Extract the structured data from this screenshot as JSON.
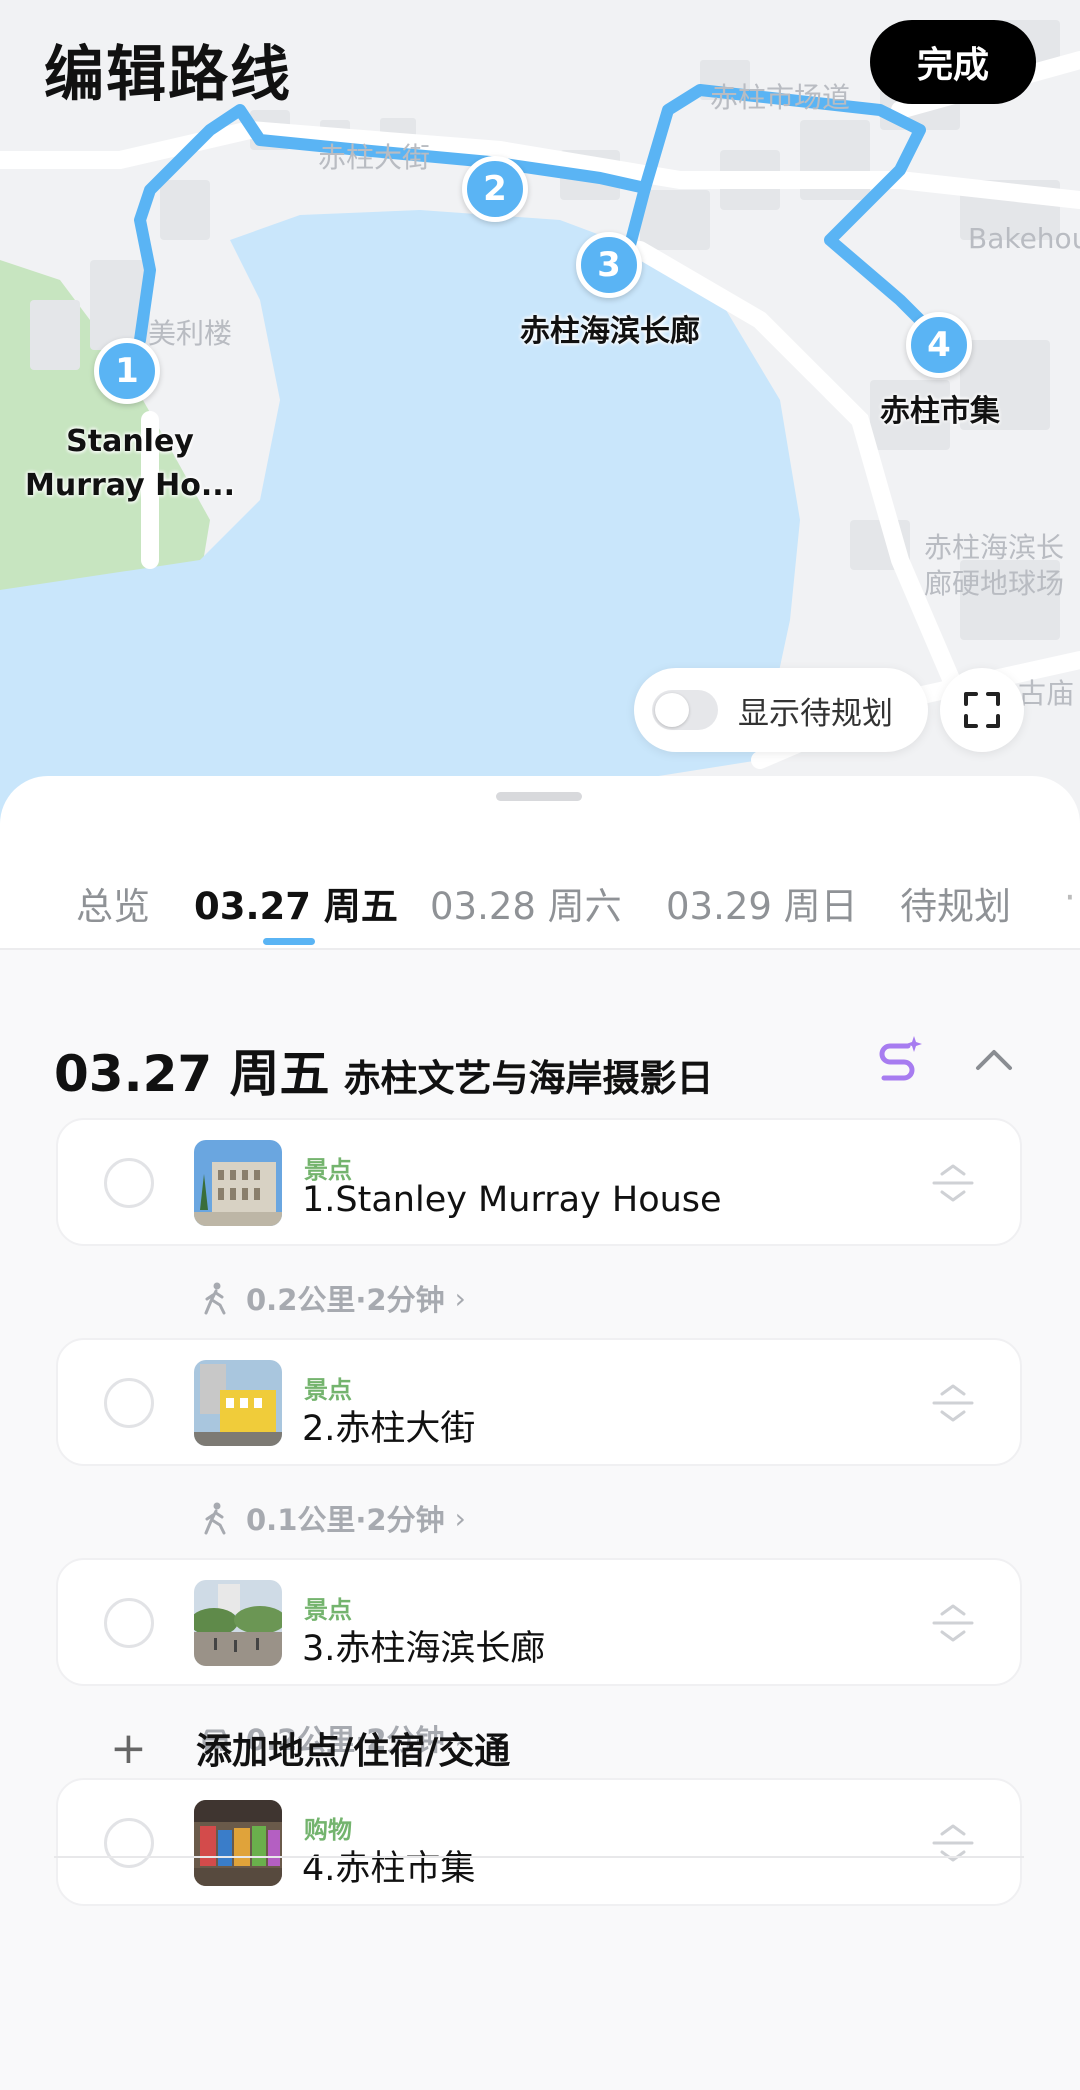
{
  "header": {
    "title": "编辑路线",
    "done_label": "完成"
  },
  "map": {
    "street_labels": {
      "stanley_main": "赤柱大街",
      "stanley_market_rd": "赤柱市场道",
      "murray_building": "美利楼",
      "bakehouse": "Bakehou",
      "promenade_court_l1": "赤柱海滨长",
      "promenade_court_l2": "廊硬地球场",
      "temple": "古庙"
    },
    "pins": [
      {
        "number": "1",
        "label_l1": "Stanley",
        "label_l2": "Murray Ho..."
      },
      {
        "number": "2",
        "label_l1": "",
        "label_l2": ""
      },
      {
        "number": "3",
        "label_l1": "赤柱海滨长廊",
        "label_l2": ""
      },
      {
        "number": "4",
        "label_l1": "赤柱市集",
        "label_l2": ""
      }
    ],
    "toggle_label": "显示待规划",
    "toggle_on": false,
    "route_color": "#5ab4f4",
    "water_color": "#c9e6fb",
    "park_color": "#c7e5c0"
  },
  "tabs": [
    {
      "label": "总览",
      "active": false
    },
    {
      "label": "03.27 周五",
      "active": true
    },
    {
      "label": "03.28 周六",
      "active": false
    },
    {
      "label": "03.29 周日",
      "active": false
    },
    {
      "label": "待规划",
      "active": false
    }
  ],
  "day": {
    "date": "03.27 周五",
    "theme": "赤柱文艺与海岸摄影日"
  },
  "stops": [
    {
      "category": "景点",
      "name": "1.Stanley Murray House",
      "icon": "colonial-building-photo"
    },
    {
      "category": "景点",
      "name": "2.赤柱大街",
      "icon": "yellow-building-photo"
    },
    {
      "category": "景点",
      "name": "3.赤柱海滨长廊",
      "icon": "waterfront-promenade-photo"
    },
    {
      "category": "购物",
      "name": "4.赤柱市集",
      "icon": "market-stall-photo"
    }
  ],
  "legs": [
    {
      "mode": "walk-icon",
      "text": "0.2公里·2分钟"
    },
    {
      "mode": "walk-icon",
      "text": "0.1公里·2分钟"
    },
    {
      "mode": "car-icon",
      "text": "0.2公里·2分钟"
    }
  ],
  "add_label": "添加地点/住宿/交通",
  "colors": {
    "accent": "#5ab4f4",
    "category_green": "#74b46e",
    "ai_purple": "#a77cf0"
  }
}
